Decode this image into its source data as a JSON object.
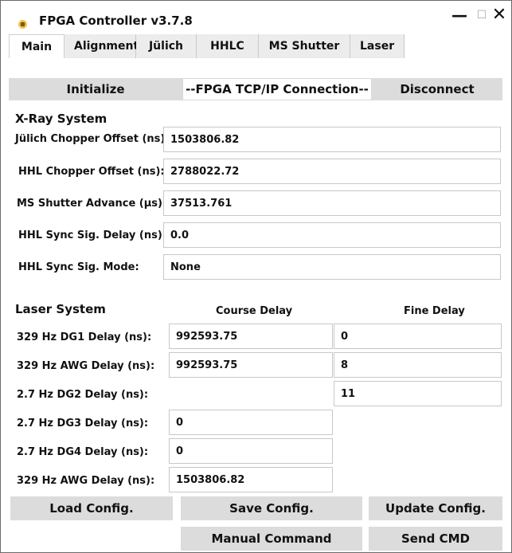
{
  "window": {
    "title": "FPGA Controller v3.7.8",
    "icon": "app-icon",
    "controls": {
      "minimize": "—",
      "maximize": "☐",
      "close": "✕"
    }
  },
  "tabs": [
    {
      "label": "Main",
      "active": true
    },
    {
      "label": "Alignment",
      "active": false
    },
    {
      "label": "Jülich",
      "active": false
    },
    {
      "label": "HHLC",
      "active": false
    },
    {
      "label": "MS Shutter",
      "active": false
    },
    {
      "label": "Laser",
      "active": false
    }
  ],
  "connection": {
    "initialize_label": "Initialize",
    "status_text": "--FPGA TCP/IP Connection--",
    "disconnect_label": "Disconnect"
  },
  "xray": {
    "title": "X-Ray System",
    "rows": [
      {
        "label": "Jülich Chopper Offset (ns):",
        "value": "1503806.82"
      },
      {
        "label": "HHL Chopper Offset (ns):",
        "value": "2788022.72"
      },
      {
        "label": "MS Shutter Advance (µs):",
        "value": "37513.761"
      },
      {
        "label": "HHL Sync Sig. Delay (ns):",
        "value": "0.0"
      },
      {
        "label": "HHL Sync Sig. Mode:",
        "value": "None"
      }
    ]
  },
  "laser": {
    "title": "Laser System",
    "course_header": "Course Delay",
    "fine_header": "Fine Delay",
    "rows": [
      {
        "label": "329 Hz DG1 Delay (ns):",
        "course": "992593.75",
        "fine": "0"
      },
      {
        "label": "329 Hz AWG Delay (ns):",
        "course": "992593.75",
        "fine": "8"
      },
      {
        "label": "2.7 Hz DG2 Delay (ns):",
        "course": "",
        "fine": "11"
      },
      {
        "label": "2.7 Hz DG3 Delay (ns):",
        "course": "0",
        "fine": ""
      },
      {
        "label": "2.7 Hz DG4 Delay (ns):",
        "course": "0",
        "fine": ""
      },
      {
        "label": "329 Hz AWG Delay (ns):",
        "course": "1503806.82",
        "fine": ""
      }
    ]
  },
  "bottom_buttons": {
    "load": "Load Config.",
    "save": "Save Config.",
    "update": "Update Config.",
    "manual": "Manual Command",
    "send": "Send CMD"
  },
  "colors": {
    "button_bg": "#dcdcdc",
    "tab_bg": "#ececec",
    "icon": "#e3a21a"
  }
}
